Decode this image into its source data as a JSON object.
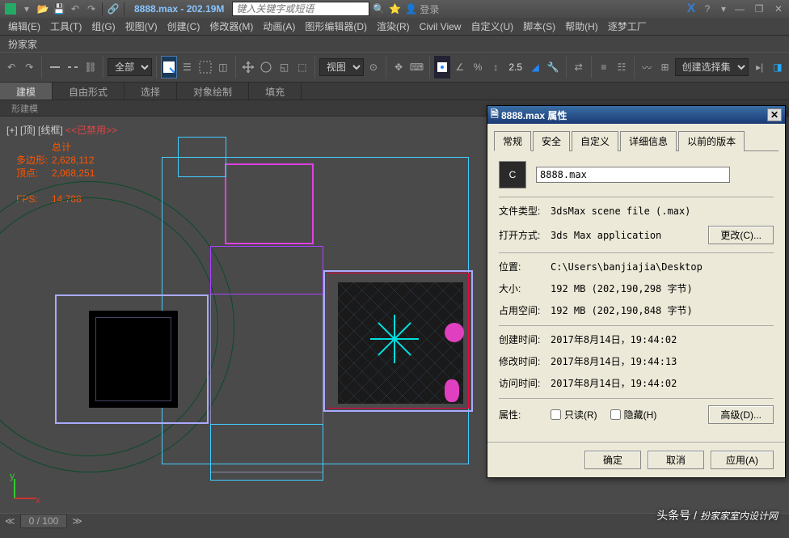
{
  "titlebar": {
    "title": "8888.max - 202.19M",
    "search_placeholder": "键入关键字或短语",
    "login": "登录"
  },
  "menu": {
    "items": [
      "编辑(E)",
      "工具(T)",
      "组(G)",
      "视图(V)",
      "创建(C)",
      "修改器(M)",
      "动画(A)",
      "图形编辑器(D)",
      "渲染(R)",
      "Civil View",
      "自定义(U)",
      "脚本(S)",
      "帮助(H)",
      "逐梦工厂"
    ],
    "row2": "扮家家"
  },
  "toolbar": {
    "filter": "全部",
    "view_label": "视图",
    "spinner_val": "2.5",
    "create_set": "创建选择集"
  },
  "tabs": {
    "items": [
      "建模",
      "自由形式",
      "选择",
      "对象绘制",
      "填充"
    ],
    "sub": "形建模"
  },
  "viewport": {
    "label_prefix": "[+] [顶] [线框]",
    "disabled": "<<已禁用>>",
    "stats_title": "总计",
    "poly_label": "多边形:",
    "poly_val": "2,628,112",
    "vert_label": "顶点:",
    "vert_val": "2,068,251",
    "fps_label": "FPS:",
    "fps_val": "14.788"
  },
  "dialog": {
    "title": "8888.max 属性",
    "tabs": [
      "常规",
      "安全",
      "自定义",
      "详细信息",
      "以前的版本"
    ],
    "filename": "8888.max",
    "rows": {
      "filetype_l": "文件类型:",
      "filetype_v": "3dsMax scene file (.max)",
      "openwith_l": "打开方式:",
      "openwith_v": "3ds Max application",
      "change_btn": "更改(C)...",
      "location_l": "位置:",
      "location_v": "C:\\Users\\banjiajia\\Desktop",
      "size_l": "大小:",
      "size_v": "192 MB (202,190,298 字节)",
      "disk_l": "占用空间:",
      "disk_v": "192 MB (202,190,848 字节)",
      "created_l": "创建时间:",
      "created_v": "2017年8月14日，19:44:02",
      "modified_l": "修改时间:",
      "modified_v": "2017年8月14日，19:44:13",
      "accessed_l": "访问时间:",
      "accessed_v": "2017年8月14日，19:44:02",
      "attr_l": "属性:",
      "readonly": "只读(R)",
      "hidden": "隐藏(H)",
      "advanced": "高级(D)..."
    },
    "buttons": {
      "ok": "确定",
      "cancel": "取消",
      "apply": "应用(A)"
    }
  },
  "bottom": {
    "frame": "0 / 100"
  },
  "watermark": {
    "pre": "头条号 /",
    "text": "扮家家室内设计网"
  }
}
